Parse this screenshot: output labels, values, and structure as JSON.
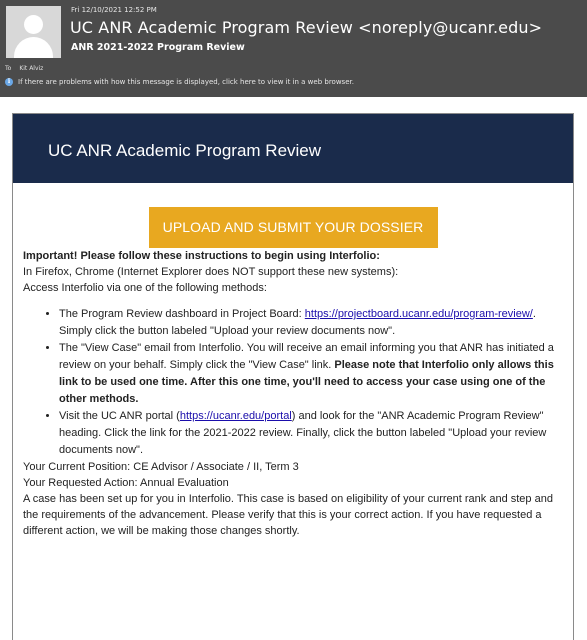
{
  "header": {
    "date": "Fri 12/10/2021 12:52 PM",
    "from": "UC ANR Academic Program Review <noreply@ucanr.edu>",
    "subject": "ANR 2021-2022 Program Review",
    "to_label": "To",
    "to_name": "Kit Alviz",
    "info_text": "If there are problems with how this message is displayed, click here to view it in a web browser."
  },
  "email": {
    "banner_title": "UC ANR Academic Program Review",
    "upload_button": "UPLOAD AND SUBMIT YOUR DOSSIER",
    "important": "Important! Please follow these instructions to begin using Interfolio:",
    "browsers": "In Firefox, Chrome (Internet Explorer does NOT support these new systems):",
    "access_intro": "Access Interfolio via one of the following methods:",
    "methods": [
      {
        "pre": "The Program Review dashboard in Project Board: ",
        "link": "https://projectboard.ucanr.edu/program-review/",
        "post": ". Simply click the button labeled \"Upload your review documents now\"."
      },
      {
        "pre": "The \"View Case\" email from Interfolio. You will receive an email informing you that ANR has initiated a review on your behalf. Simply click the \"View Case\" link. ",
        "bold": "Please note that Interfolio only allows this link to be used one time. After this one time, you'll need to access your case using one of the other methods."
      },
      {
        "pre": "Visit the UC ANR portal (",
        "link": "https://ucanr.edu/portal",
        "post": ") and look for the \"ANR Academic Program Review\" heading. Click the link for the 2021-2022 review. Finally, click the button labeled \"Upload your review documents now\"."
      }
    ],
    "current_position": "Your Current Position: CE Advisor / Associate / II, Term 3",
    "requested_action": "Your Requested Action: Annual Evaluation",
    "case_text": "A case has been set up for you in Interfolio. This case is based on eligibility of your current rank and step and the requirements of the advancement. Please verify that this is your correct action. If you have requested a different action, we will be making those changes shortly."
  }
}
